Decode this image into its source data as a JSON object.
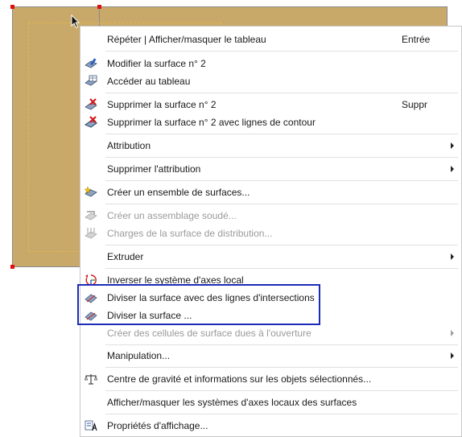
{
  "colors": {
    "surface_fill": "#c9a96a",
    "handle": "#e01010",
    "highlight_border": "#1d2bb8",
    "disabled_text": "#9a9a9a"
  },
  "context_menu": {
    "items": [
      {
        "label": "Répéter | Afficher/masquer le tableau",
        "shortcut": "Entrée",
        "icon": "none",
        "enabled": true
      },
      {
        "label": "Modifier la surface n° 2",
        "icon": "edit-surface-icon",
        "enabled": true
      },
      {
        "label": "Accéder au tableau",
        "icon": "table-icon",
        "enabled": true
      },
      {
        "label": "Supprimer la surface n° 2",
        "shortcut": "Suppr",
        "icon": "delete-surface-icon",
        "enabled": true
      },
      {
        "label": "Supprimer la surface n° 2 avec lignes de contour",
        "icon": "delete-surface-lines-icon",
        "enabled": true
      },
      {
        "label": "Attribution",
        "submenu": true,
        "enabled": true
      },
      {
        "label": "Supprimer l'attribution",
        "submenu": true,
        "enabled": true
      },
      {
        "label": "Créer un ensemble de surfaces...",
        "icon": "surface-set-icon",
        "enabled": true
      },
      {
        "label": "Créer un assemblage soudé...",
        "icon": "welded-assembly-icon",
        "enabled": false
      },
      {
        "label": "Charges de la surface de distribution...",
        "icon": "load-distribution-icon",
        "enabled": false
      },
      {
        "label": "Extruder",
        "submenu": true,
        "enabled": true
      },
      {
        "label": "Inverser le système d'axes local",
        "icon": "reverse-axes-icon",
        "enabled": true
      },
      {
        "label": "Diviser la surface avec des lignes d'intersections",
        "icon": "split-surface-icon",
        "enabled": true
      },
      {
        "label": "Diviser la surface ...",
        "icon": "split-surface-icon",
        "enabled": true
      },
      {
        "label": "Créer des cellules de surface dues à l'ouverture",
        "submenu": true,
        "enabled": false
      },
      {
        "label": "Manipulation...",
        "submenu": true,
        "enabled": true
      },
      {
        "label": "Centre de gravité et informations sur les objets sélectionnés...",
        "icon": "balance-icon",
        "enabled": true
      },
      {
        "label": "Afficher/masquer les systèmes d'axes locaux des surfaces",
        "enabled": true
      },
      {
        "label": "Propriétés d'affichage...",
        "icon": "display-properties-icon",
        "enabled": true
      }
    ]
  }
}
